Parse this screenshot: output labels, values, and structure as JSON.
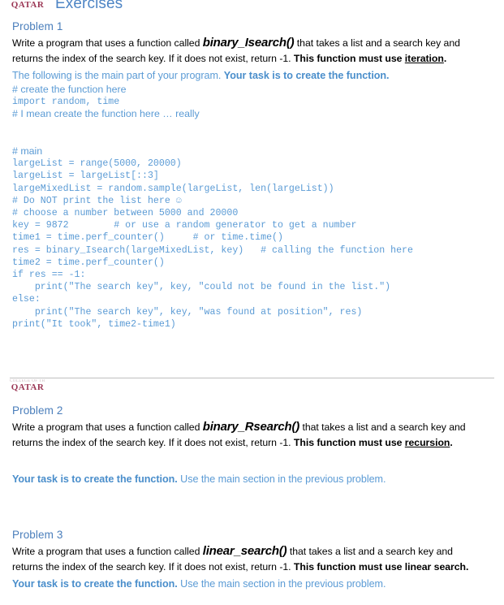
{
  "document": {
    "title": "Exercises",
    "logo_top_line": "COLLEGE OF THE",
    "logo_main_line": "QATAR"
  },
  "problems": [
    {
      "heading": "Problem 1",
      "body_prefix": "Write a program that uses a function called ",
      "function_name": "binary_Isearch()",
      "body_middle": " that takes a list and a search key and returns the index of the search key. If it does not exist, return -1. ",
      "body_bold_prefix": "This function must use ",
      "body_bold_underline": "iteration",
      "body_bold_suffix": ".",
      "task_normal": "The following is the main part of your program. ",
      "task_bold": "Your task is to create the function.",
      "task_suffix": ""
    },
    {
      "heading": "Problem 2",
      "body_prefix": "Write a program that uses a function called ",
      "function_name": "binary_Rsearch()",
      "body_middle": " that takes a list and a search key and returns the index of the search key. If it does not exist, return -1. ",
      "body_bold_prefix": "This function must use ",
      "body_bold_underline": "recursion",
      "body_bold_suffix": ".",
      "task_normal": "",
      "task_bold": "Your task is to create the function.",
      "task_suffix": " Use the main section in the previous problem."
    },
    {
      "heading": "Problem 3",
      "body_prefix": "Write a program that uses a function called ",
      "function_name": "linear_search()",
      "body_middle": " that takes a list and a search key and returns the index of the search key. If it does not exist, return -1. ",
      "body_bold_prefix": "This function must use linear search.",
      "body_bold_underline": "",
      "body_bold_suffix": "",
      "task_normal": "",
      "task_bold": "Your task is to create the function.",
      "task_suffix": " Use the main section in the previous problem."
    }
  ],
  "code": {
    "lines": [
      {
        "style": "prop",
        "text": "# create the function here"
      },
      {
        "style": "mono",
        "text": "import random, time"
      },
      {
        "style": "prop",
        "text": "# I mean create the function here … really"
      },
      {
        "style": "spacer",
        "text": ""
      },
      {
        "style": "spacer",
        "text": ""
      },
      {
        "style": "prop",
        "text": "# main"
      },
      {
        "style": "mono",
        "text": "largeList = range(5000, 20000)"
      },
      {
        "style": "mono",
        "text": "largeList = largeList[::3]"
      },
      {
        "style": "mono",
        "text": "largeMixedList = random.sample(largeList, len(largeList))"
      },
      {
        "style": "mono",
        "text": "# Do NOT print the list here ☺"
      },
      {
        "style": "mono",
        "text": "# choose a number between 5000 and 20000"
      },
      {
        "style": "mono",
        "text": "key = 9872        # or use a random generator to get a number"
      },
      {
        "style": "mono",
        "text": "time1 = time.perf_counter()     # or time.time()"
      },
      {
        "style": "mono",
        "text": "res = binary_Isearch(largeMixedList, key)   # calling the function here"
      },
      {
        "style": "mono",
        "text": "time2 = time.perf_counter()"
      },
      {
        "style": "mono",
        "text": "if res == -1:"
      },
      {
        "style": "mono",
        "text": "    print(\"The search key\", key, \"could not be found in the list.\")"
      },
      {
        "style": "mono",
        "text": "else:"
      },
      {
        "style": "mono",
        "text": "    print(\"The search key\", key, \"was found at position\", res)"
      },
      {
        "style": "mono",
        "text": "print(\"It took\", time2-time1)"
      }
    ]
  },
  "colors": {
    "heading_blue": "#4a7ebb",
    "code_blue": "#5b9bd5",
    "title_blue": "#4e85c5",
    "logo_maroon": "#8a1538",
    "divider_gray": "#bfbfbf",
    "body_black": "#000000"
  }
}
